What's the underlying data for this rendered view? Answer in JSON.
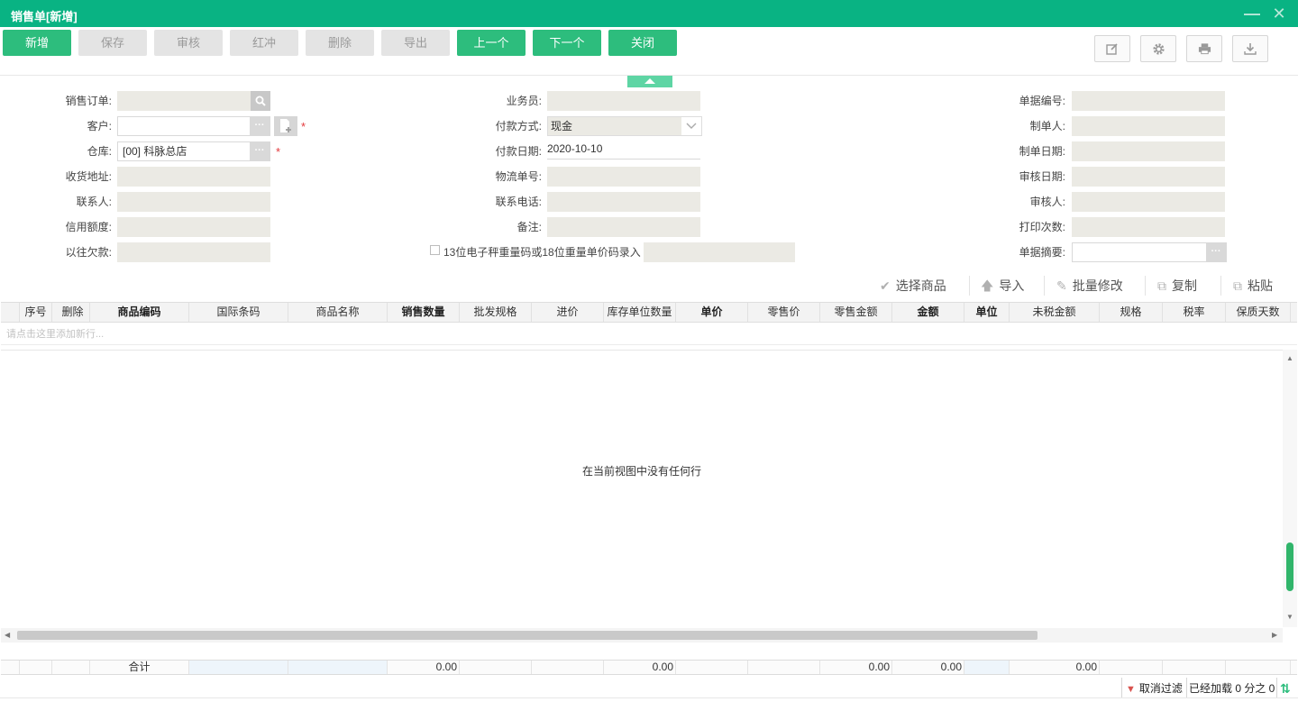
{
  "window": {
    "title": "销售单[新增]"
  },
  "toolbar": {
    "buttons": [
      {
        "label": "新增",
        "enabled": true
      },
      {
        "label": "保存",
        "enabled": false
      },
      {
        "label": "审核",
        "enabled": false
      },
      {
        "label": "红冲",
        "enabled": false
      },
      {
        "label": "删除",
        "enabled": false
      },
      {
        "label": "导出",
        "enabled": false
      },
      {
        "label": "上一个",
        "enabled": true
      },
      {
        "label": "下一个",
        "enabled": true
      },
      {
        "label": "关闭",
        "enabled": true
      }
    ],
    "icons": [
      "edit-icon",
      "gear-icon",
      "print-icon",
      "download-icon"
    ]
  },
  "form": {
    "left": [
      {
        "label": "销售订单:",
        "value": "",
        "button": "search-icon"
      },
      {
        "label": "客户:",
        "value": "",
        "button": "more-icon",
        "required": true
      },
      {
        "label": "仓库:",
        "value": "[00] 科脉总店",
        "button": "more-icon",
        "required": true
      },
      {
        "label": "收货地址:",
        "value": ""
      },
      {
        "label": "联系人:",
        "value": ""
      },
      {
        "label": "信用额度:",
        "value": ""
      },
      {
        "label": "以往欠款:",
        "value": ""
      }
    ],
    "middle": [
      {
        "label": "业务员:",
        "value": ""
      },
      {
        "label": "付款方式:",
        "value": "现金"
      },
      {
        "label": "付款日期:",
        "value": "2020-10-10"
      },
      {
        "label": "物流单号:",
        "value": ""
      },
      {
        "label": "联系电话:",
        "value": ""
      },
      {
        "label": "备注:",
        "value": ""
      }
    ],
    "scale_checkbox_label": "13位电子秤重量码或18位重量单价码录入",
    "right": [
      {
        "label": "单据编号:",
        "value": ""
      },
      {
        "label": "制单人:",
        "value": ""
      },
      {
        "label": "制单日期:",
        "value": ""
      },
      {
        "label": "审核日期:",
        "value": ""
      },
      {
        "label": "审核人:",
        "value": ""
      },
      {
        "label": "打印次数:",
        "value": ""
      },
      {
        "label": "单据摘要:",
        "value": ""
      }
    ]
  },
  "actions": [
    "选择商品",
    "导入",
    "批量修改",
    "复制",
    "粘贴"
  ],
  "grid": {
    "columns": [
      "序号",
      "删除",
      "商品编码",
      "国际条码",
      "商品名称",
      "销售数量",
      "批发规格",
      "进价",
      "库存单位数量",
      "单价",
      "零售价",
      "零售金额",
      "金额",
      "单位",
      "未税金额",
      "规格",
      "税率",
      "保质天数"
    ],
    "new_row_hint": "请点击这里添加新行...",
    "empty_text": "在当前视图中没有任何行",
    "totals": {
      "label": "合计",
      "sales_qty": "0.00",
      "stock_qty": "0.00",
      "retail_amount": "0.00",
      "amount": "0.00",
      "untaxed_amount": "0.00"
    }
  },
  "status": {
    "cancel_filter": "取消过滤",
    "loaded": "已经加载 0 分之 0"
  },
  "colors": {
    "brand": "#09b383",
    "button": "#2dbd7d",
    "field_bg": "#ebeae4"
  }
}
